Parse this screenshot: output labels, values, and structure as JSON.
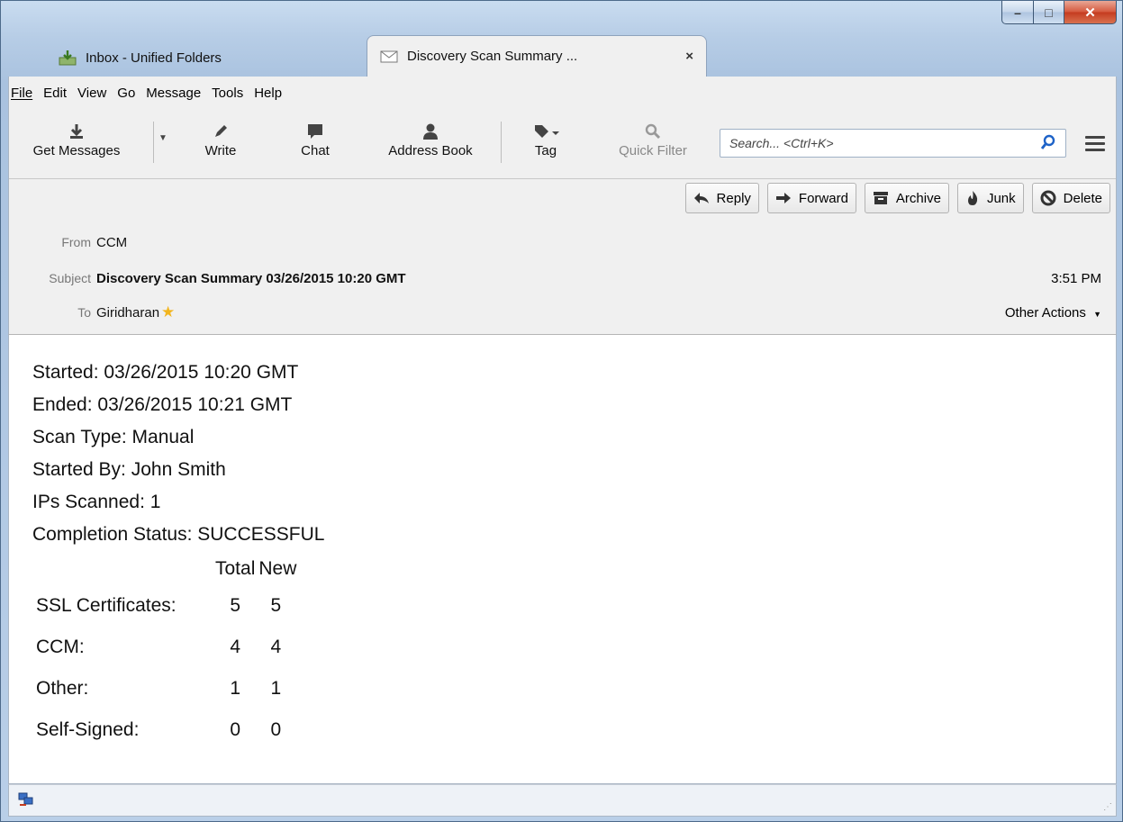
{
  "window": {
    "caption_min": "–",
    "caption_max": "□",
    "caption_close": "✕"
  },
  "tabs": [
    {
      "label": "Inbox - Unified Folders",
      "icon": "inbox-download-icon"
    },
    {
      "label": "Discovery Scan Summary ...",
      "icon": "envelope-icon",
      "close": "×"
    }
  ],
  "menu": [
    "File",
    "Edit",
    "View",
    "Go",
    "Message",
    "Tools",
    "Help"
  ],
  "toolbar": {
    "get_messages": "Get Messages",
    "write": "Write",
    "chat": "Chat",
    "address_book": "Address Book",
    "tag": "Tag",
    "quick_filter": "Quick Filter",
    "search_placeholder": "Search... <Ctrl+K>"
  },
  "actions": {
    "reply": "Reply",
    "forward": "Forward",
    "archive": "Archive",
    "junk": "Junk",
    "delete": "Delete"
  },
  "header": {
    "from_label": "From",
    "from_value": "CCM",
    "subject_label": "Subject",
    "subject_value": "Discovery Scan Summary 03/26/2015 10:20 GMT",
    "time": "3:51 PM",
    "to_label": "To",
    "to_value": "Giridharan",
    "other_actions": "Other Actions"
  },
  "body": {
    "lines": [
      "Started: 03/26/2015 10:20 GMT",
      "Ended: 03/26/2015 10:21 GMT",
      "Scan Type: Manual",
      "Started By: John Smith",
      "IPs Scanned: 1",
      "Completion Status: SUCCESSFUL"
    ],
    "table": {
      "headers": [
        "",
        "Total",
        "New"
      ],
      "rows": [
        {
          "label": "SSL Certificates:",
          "total": "5",
          "new": "5"
        },
        {
          "label": "CCM:",
          "total": "4",
          "new": "4"
        },
        {
          "label": "Other:",
          "total": "1",
          "new": "1"
        },
        {
          "label": "Self-Signed:",
          "total": "0",
          "new": "0"
        }
      ]
    }
  },
  "colors": {
    "accent": "#1e63c8",
    "close_red": "#c43b1f"
  }
}
